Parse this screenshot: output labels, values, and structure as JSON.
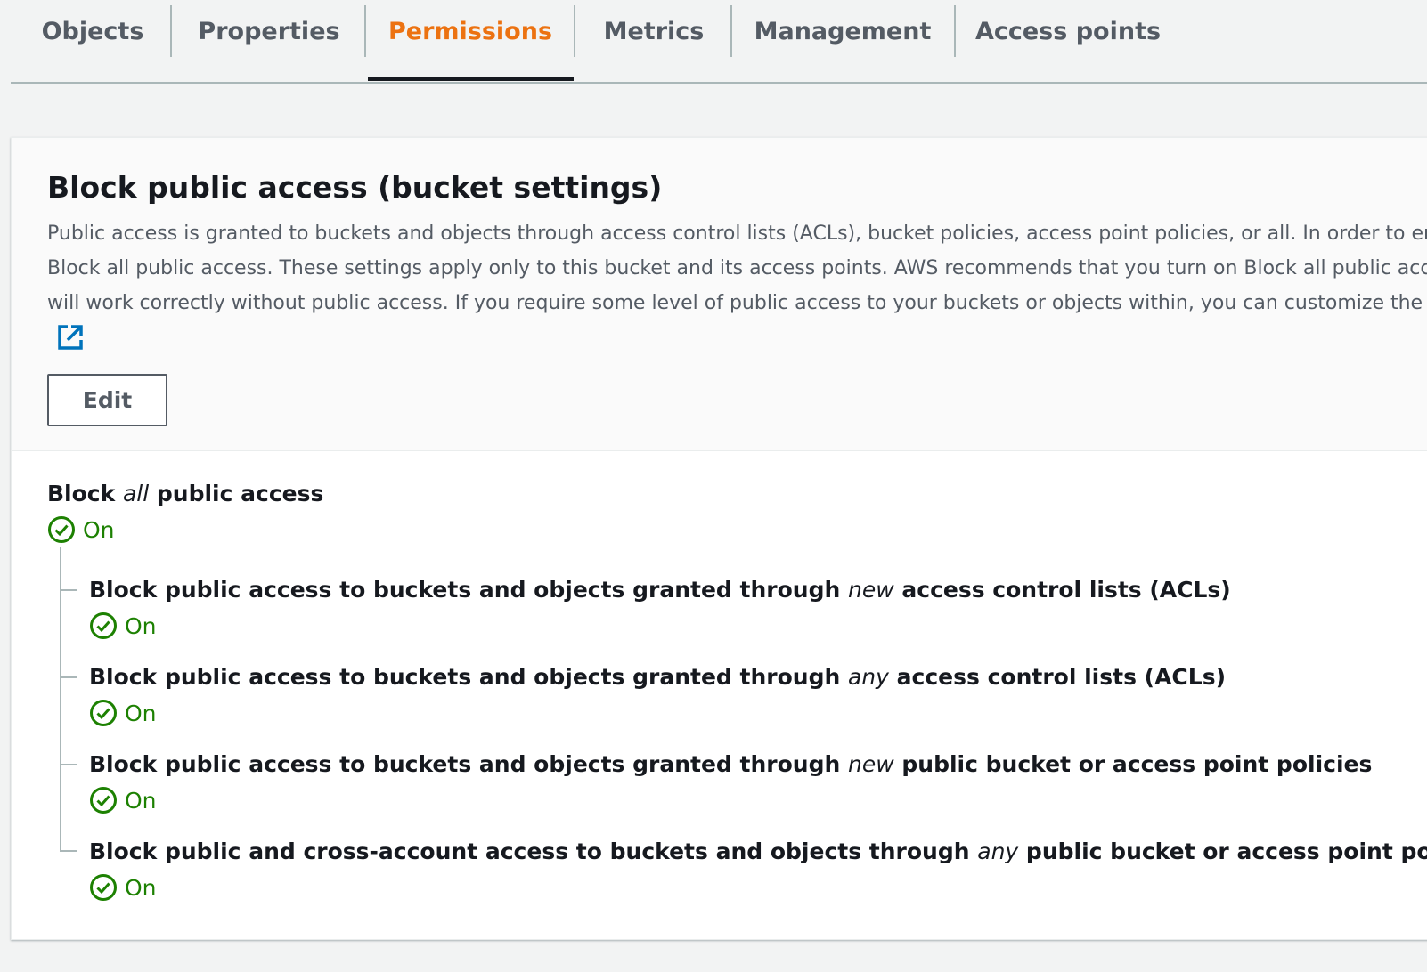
{
  "tabs": {
    "objects": "Objects",
    "properties": "Properties",
    "permissions": "Permissions",
    "metrics": "Metrics",
    "management": "Management",
    "access_points": "Access points"
  },
  "active_tab": "Permissions",
  "colors": {
    "active_tab": "#ec7211",
    "status_on": "#1d8102",
    "link": "#0073bb"
  },
  "panel": {
    "title": "Block public access (bucket settings)",
    "description_lines": [
      "Public access is granted to buckets and objects through access control lists (ACLs), bucket policies, access point policies, or all. In order to ensure",
      "Block all public access. These settings apply only to this bucket and its access points. AWS recommends that you turn on Block all public access,",
      "will work correctly without public access. If you require some level of public access to your buckets or objects within, you can customize the ind"
    ],
    "external_link_icon": "external-link-icon",
    "edit_label": "Edit"
  },
  "block_all": {
    "prefix": "Block ",
    "emphasis": "all",
    "suffix": " public access",
    "status": "On"
  },
  "settings": [
    {
      "prefix": "Block public access to buckets and objects granted through ",
      "emphasis": "new",
      "suffix": " access control lists (ACLs)",
      "status": "On"
    },
    {
      "prefix": "Block public access to buckets and objects granted through ",
      "emphasis": "any",
      "suffix": " access control lists (ACLs)",
      "status": "On"
    },
    {
      "prefix": "Block public access to buckets and objects granted through ",
      "emphasis": "new",
      "suffix": " public bucket or access point policies",
      "status": "On"
    },
    {
      "prefix": "Block public and cross-account access to buckets and objects through ",
      "emphasis": "any",
      "suffix": " public bucket or access point policies",
      "status": "On"
    }
  ]
}
